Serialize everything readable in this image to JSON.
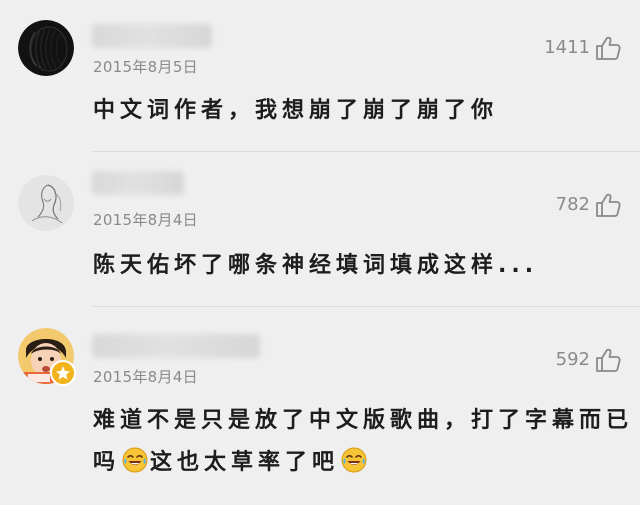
{
  "comments": [
    {
      "date": "2015年8月5日",
      "likes": "1411",
      "text": "中文词作者，我想崩了崩了崩了你"
    },
    {
      "date": "2015年8月4日",
      "likes": "782",
      "text": "陈天佑坏了哪条神经填词填成这样..."
    },
    {
      "date": "2015年8月4日",
      "likes": "592",
      "text_line1": "难道不是只是放了中文版歌曲，打了字幕而已",
      "text_line2_a": "吗",
      "text_line2_b": "这也太草率了吧",
      "emoji": "laugh-cry-icon"
    }
  ],
  "icons": {
    "like": "thumbs-up-icon",
    "badge": "star-badge-icon"
  },
  "colors": {
    "background": "#efefef",
    "meta_text": "#8a8a8a",
    "comment_text": "#1d1d1d",
    "badge": "#f2b31c"
  }
}
